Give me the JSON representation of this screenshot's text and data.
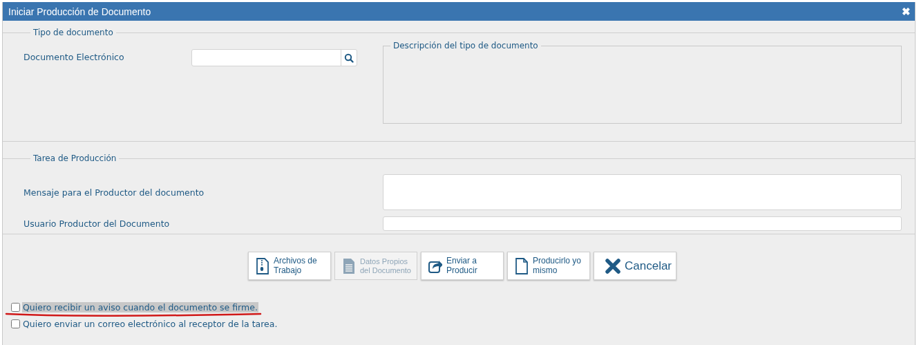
{
  "dialog": {
    "title": "Iniciar Producción de Documento",
    "close_icon": "✖"
  },
  "tipo_de_documento": {
    "legend": "Tipo de documento",
    "label": "Documento Electrónico",
    "description": {
      "legend": "Descripción del tipo de documento"
    }
  },
  "tarea_de_produccion": {
    "legend": "Tarea de Producción",
    "fields": [
      {
        "label": "Mensaje para el Productor del documento",
        "kind": "textarea"
      },
      {
        "label": "Usuario Productor del Documento",
        "kind": "input"
      }
    ]
  },
  "buttons": [
    {
      "label": "Archivos de Trabajo",
      "kind": "zip",
      "disabled": false
    },
    {
      "label": "Datos Propios del Documento",
      "kind": "details",
      "disabled": true
    },
    {
      "label": "Enviar a Producir",
      "kind": "send",
      "disabled": false
    },
    {
      "label": "Producirlo yo mismo",
      "kind": "produce",
      "disabled": false
    },
    {
      "label": "Cancelar",
      "kind": "cancel",
      "disabled": false
    }
  ],
  "options": [
    {
      "label": "Quiero recibir un aviso cuando el documento se firme.",
      "checked": false,
      "highlighted": true,
      "underlined": true
    },
    {
      "label": "Quiero enviar un correo electrónico al receptor de la tarea.",
      "checked": false,
      "highlighted": false,
      "underlined": false
    }
  ]
}
